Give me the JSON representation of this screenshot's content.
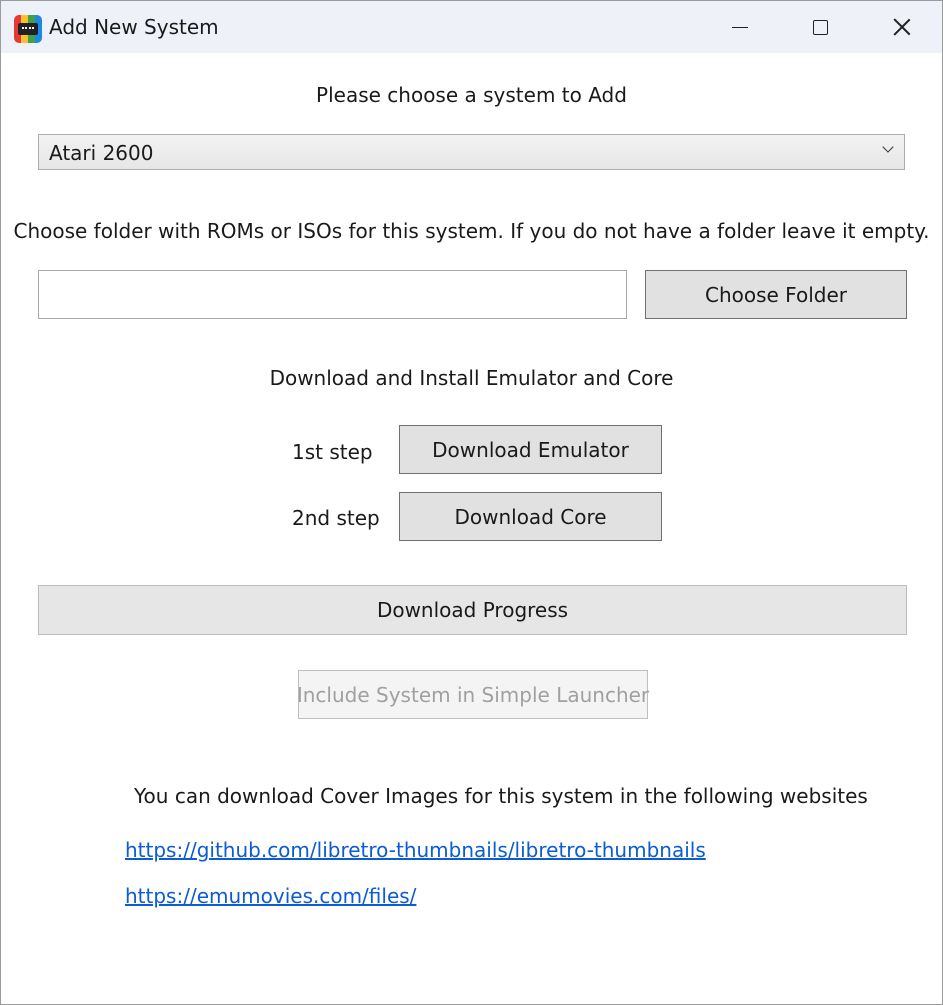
{
  "window": {
    "title": "Add New System",
    "controls": {
      "minimize": "minimize-icon",
      "maximize": "maximize-icon",
      "close": "close-icon"
    }
  },
  "system_prompt": "Please choose a system to Add",
  "system_select": {
    "selected": "Atari 2600"
  },
  "folder_prompt": "Choose folder with ROMs or ISOs for this system. If you do not have a folder leave it empty.",
  "folder_input": {
    "value": "",
    "placeholder": ""
  },
  "choose_folder_label": "Choose Folder",
  "download_heading": "Download and Install Emulator and Core",
  "steps": {
    "step1_label": "1st step",
    "step1_button": "Download Emulator",
    "step2_label": "2nd step",
    "step2_button": "Download Core"
  },
  "progress": {
    "label": "Download Progress",
    "value": 0
  },
  "include_button": "Include System in Simple Launcher",
  "cover_images_text": "You can download Cover Images for this system in the following websites",
  "links": [
    "https://github.com/libretro-thumbnails/libretro-thumbnails",
    "https://emumovies.com/files/"
  ],
  "colors": {
    "link": "#0b5cd5",
    "button_bg": "#e1e1e1",
    "disabled_text": "#a0a0a0",
    "progress_fill": "#06b025"
  }
}
